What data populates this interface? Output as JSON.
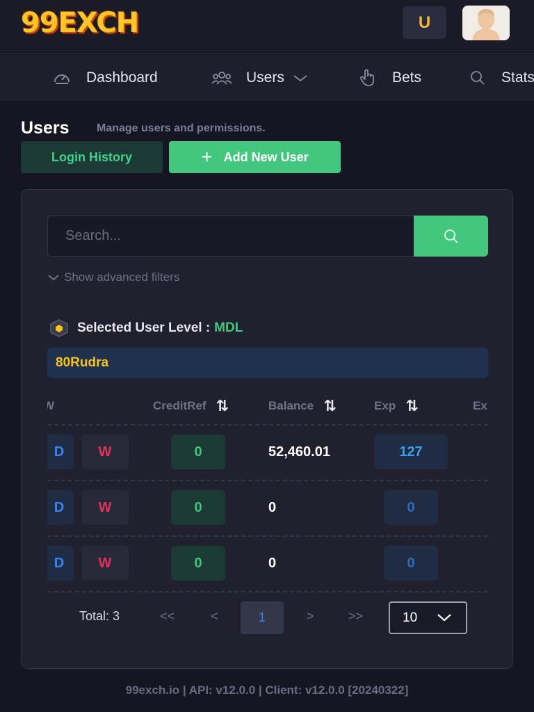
{
  "brand": {
    "logo_text": "99EXCH",
    "user_initial": "U"
  },
  "nav": {
    "dashboard": "Dashboard",
    "users": "Users",
    "bets": "Bets",
    "stats": "Stats"
  },
  "header": {
    "title": "Users",
    "subtitle": "Manage users and permissions.",
    "login_history": "Login History",
    "add_user": "Add New User"
  },
  "search": {
    "placeholder": "Search...",
    "advanced": "Show advanced filters"
  },
  "level": {
    "label": "Selected User Level :",
    "value": "MDL",
    "user": "80Rudra"
  },
  "table": {
    "headers": {
      "w": "W",
      "credit": "CreditRef",
      "balance": "Balance",
      "exp": "Exp",
      "ex": "Ex"
    },
    "rows": [
      {
        "d": "D",
        "w": "W",
        "credit": "0",
        "balance": "52,460.01",
        "exp": "127"
      },
      {
        "d": "D",
        "w": "W",
        "credit": "0",
        "balance": "0",
        "exp": "0"
      },
      {
        "d": "D",
        "w": "W",
        "credit": "0",
        "balance": "0",
        "exp": "0"
      }
    ]
  },
  "pagination": {
    "total": "Total: 3",
    "first": "<<",
    "prev": "<",
    "page": "1",
    "next": ">",
    "last": ">>",
    "page_size": "10"
  },
  "footer": "99exch.io | API: v12.0.0 | Client: v12.0.0 [20240322]",
  "colors": {
    "accent": "#43c77f",
    "gold": "#f5c518",
    "link": "#3b82f6",
    "danger": "#e0335a",
    "bg": "#161622"
  }
}
